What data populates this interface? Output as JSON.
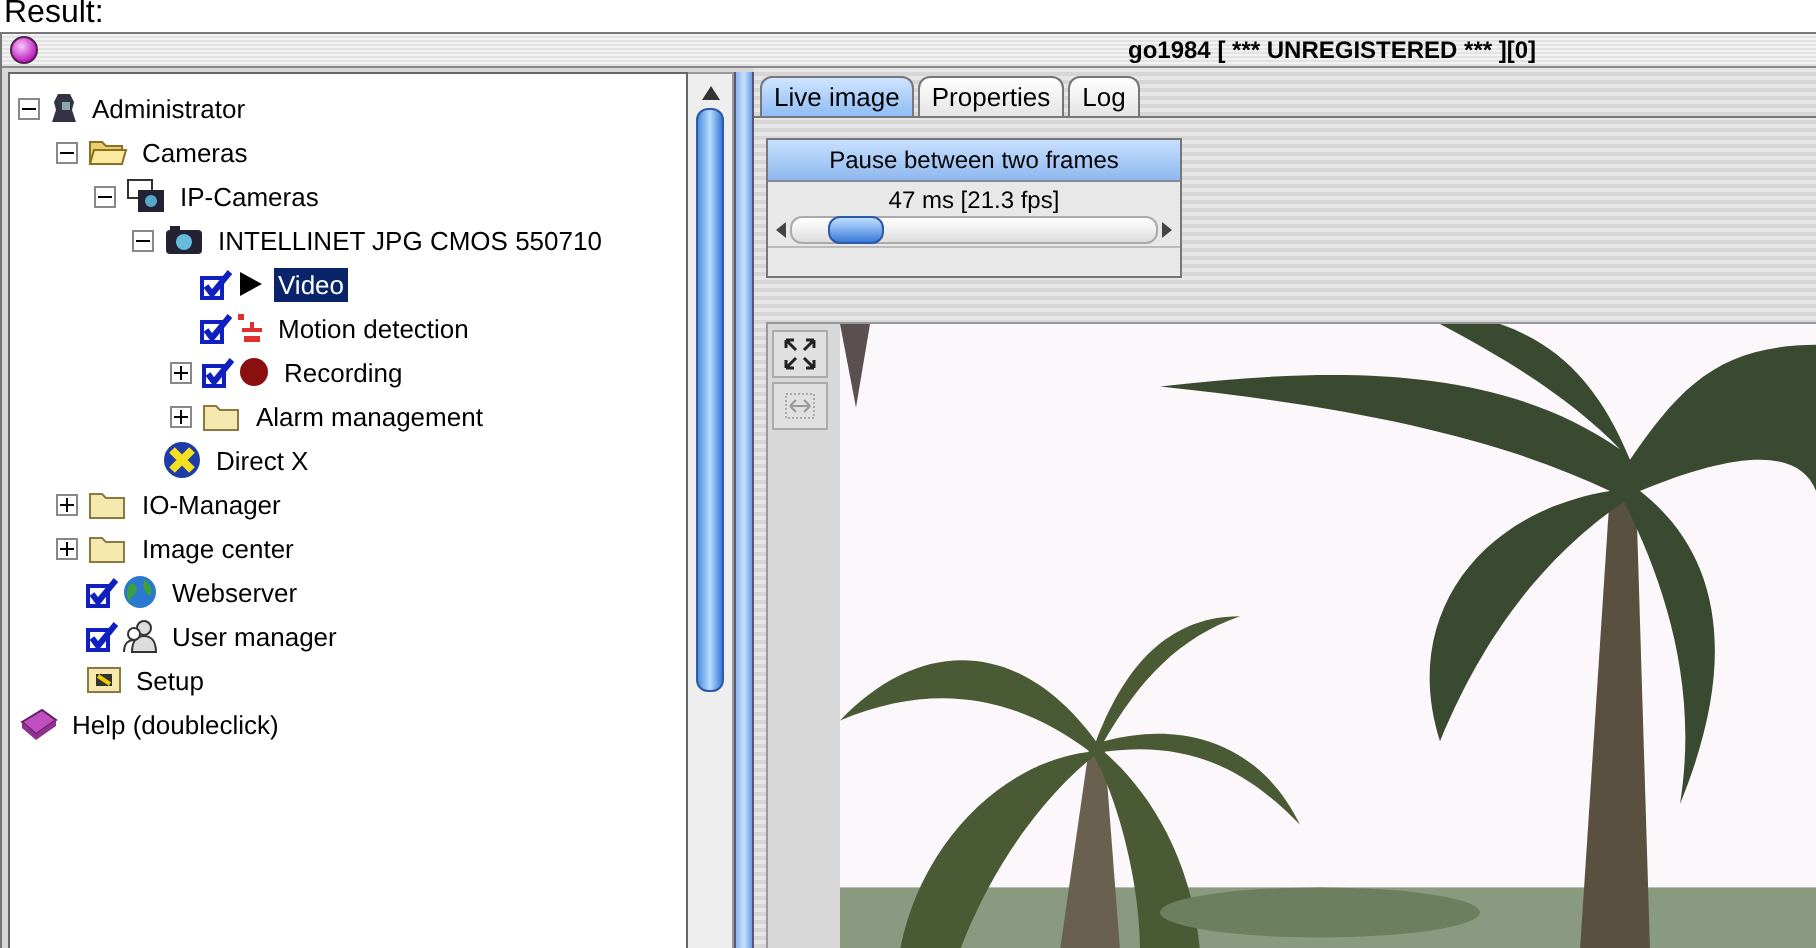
{
  "caption": "Result:",
  "window": {
    "title": "go1984 [ *** UNREGISTERED *** ][0]"
  },
  "tree": [
    {
      "label": "Administrator",
      "kind": "person",
      "expanded": true,
      "selected": false,
      "children": [
        {
          "label": "Cameras",
          "kind": "folder-open",
          "expanded": true,
          "selected": false,
          "children": [
            {
              "label": "IP-Cameras",
              "kind": "ipcam",
              "expanded": true,
              "selected": false,
              "children": [
                {
                  "label": "INTELLINET JPG CMOS 550710",
                  "kind": "camera",
                  "expanded": true,
                  "selected": false,
                  "children": [
                    {
                      "label": "Video",
                      "kind": "play",
                      "checked": true,
                      "selected": true
                    },
                    {
                      "label": "Motion detection",
                      "kind": "motion",
                      "checked": true,
                      "selected": false
                    },
                    {
                      "label": "Recording",
                      "kind": "record",
                      "checked": true,
                      "expanded": false,
                      "selected": false
                    },
                    {
                      "label": "Alarm management",
                      "kind": "folder",
                      "expanded": false,
                      "selected": false
                    }
                  ]
                },
                {
                  "label": "Direct X",
                  "kind": "directx",
                  "selected": false
                }
              ]
            }
          ]
        },
        {
          "label": "IO-Manager",
          "kind": "folder",
          "expanded": false,
          "selected": false
        },
        {
          "label": "Image center",
          "kind": "folder",
          "expanded": false,
          "selected": false
        },
        {
          "label": "Webserver",
          "kind": "globe",
          "checked": true,
          "selected": false
        },
        {
          "label": "User manager",
          "kind": "users",
          "checked": true,
          "selected": false
        },
        {
          "label": "Setup",
          "kind": "setup",
          "selected": false
        }
      ]
    },
    {
      "label": "Help (doubleclick)",
      "kind": "book",
      "selected": false
    }
  ],
  "tabs": [
    {
      "label": "Live image",
      "selected": true
    },
    {
      "label": "Properties",
      "selected": false
    },
    {
      "label": "Log",
      "selected": false
    }
  ],
  "frame_pause": {
    "title": "Pause between two frames",
    "reading": "47 ms [21.3 fps]",
    "level": 0.12
  }
}
